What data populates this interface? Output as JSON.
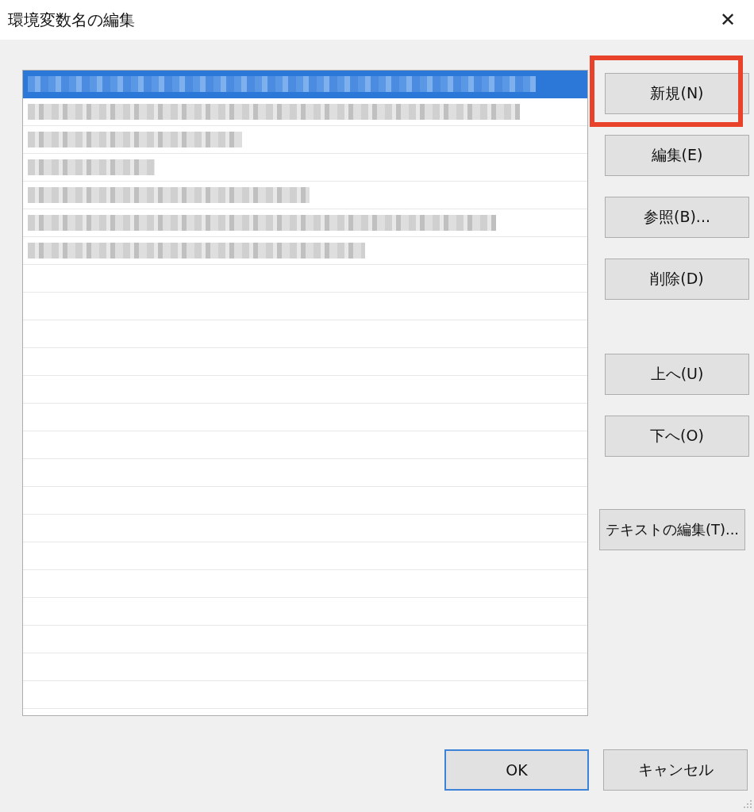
{
  "window": {
    "title": "環境変数名の編集",
    "close": "✕"
  },
  "list": {
    "rows": [
      {
        "selected": true,
        "redacted": true
      },
      {
        "selected": false,
        "redacted": true
      },
      {
        "selected": false,
        "redacted": true
      },
      {
        "selected": false,
        "redacted": true
      },
      {
        "selected": false,
        "redacted": true
      },
      {
        "selected": false,
        "redacted": true
      },
      {
        "selected": false,
        "redacted": true
      }
    ]
  },
  "button_groups": [
    [
      {
        "label": "新規(N)",
        "highlighted": true
      },
      {
        "label": "編集(E)",
        "highlighted": false
      },
      {
        "label": "参照(B)...",
        "highlighted": false
      },
      {
        "label": "削除(D)",
        "highlighted": false
      }
    ],
    [
      {
        "label": "上へ(U)",
        "highlighted": false
      },
      {
        "label": "下へ(O)",
        "highlighted": false
      }
    ],
    [
      {
        "label": "テキストの編集(T)...",
        "highlighted": false
      }
    ]
  ],
  "footer": [
    {
      "label": "OK",
      "default": true
    },
    {
      "label": "キャンセル",
      "default": false
    }
  ]
}
